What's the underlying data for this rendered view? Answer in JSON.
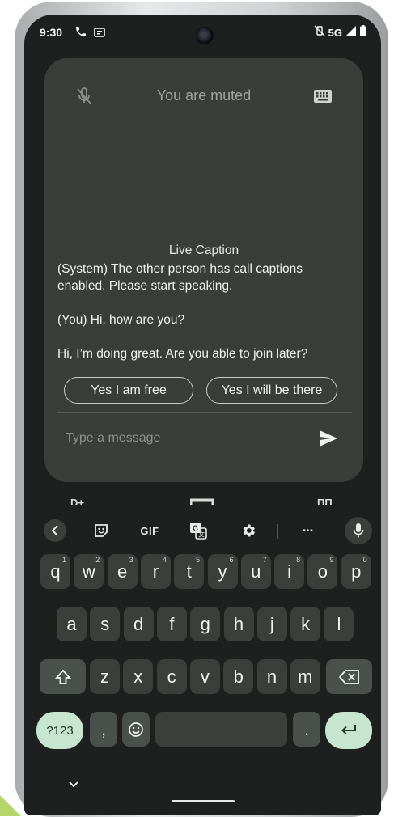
{
  "status_bar": {
    "time": "9:30",
    "network": "5G"
  },
  "call": {
    "muted_label": "You are muted",
    "caption_title": "Live Caption",
    "captions": [
      "(System) The other person has call captions enabled. Please start speaking.",
      "(You) Hi, how are you?",
      "Hi, I’m doing great. Are you able to join later?"
    ],
    "suggestions": [
      "Yes I am free",
      "Yes I will be there"
    ],
    "message_placeholder": "Type a message"
  },
  "keyboard": {
    "toolbar": {
      "back_icon": "chevron-left-icon",
      "sticker_icon": "sticker-icon",
      "gif_label": "GIF",
      "translate_icon": "translate-icon",
      "settings_icon": "gear-icon",
      "more_label": "•••",
      "mic_icon": "mic-icon"
    },
    "row1": [
      {
        "k": "q",
        "n": "1"
      },
      {
        "k": "w",
        "n": "2"
      },
      {
        "k": "e",
        "n": "3"
      },
      {
        "k": "r",
        "n": "4"
      },
      {
        "k": "t",
        "n": "5"
      },
      {
        "k": "y",
        "n": "6"
      },
      {
        "k": "u",
        "n": "7"
      },
      {
        "k": "i",
        "n": "8"
      },
      {
        "k": "o",
        "n": "9"
      },
      {
        "k": "p",
        "n": "0"
      }
    ],
    "row2": [
      "a",
      "s",
      "d",
      "f",
      "g",
      "h",
      "j",
      "k",
      "l"
    ],
    "row3": [
      "z",
      "x",
      "c",
      "v",
      "b",
      "n",
      "m"
    ],
    "symbols_label": "?123",
    "comma_label": ",",
    "period_label": ".",
    "emoji_icon": "emoji-icon",
    "enter_icon": "enter-icon",
    "shift_icon": "shift-icon",
    "backspace_icon": "backspace-icon"
  },
  "colors": {
    "screen_bg": "#1e2020",
    "card_bg": "#3a3e3b",
    "key_bg": "#3b3f3c",
    "accent_key": "#c7e6cf"
  }
}
